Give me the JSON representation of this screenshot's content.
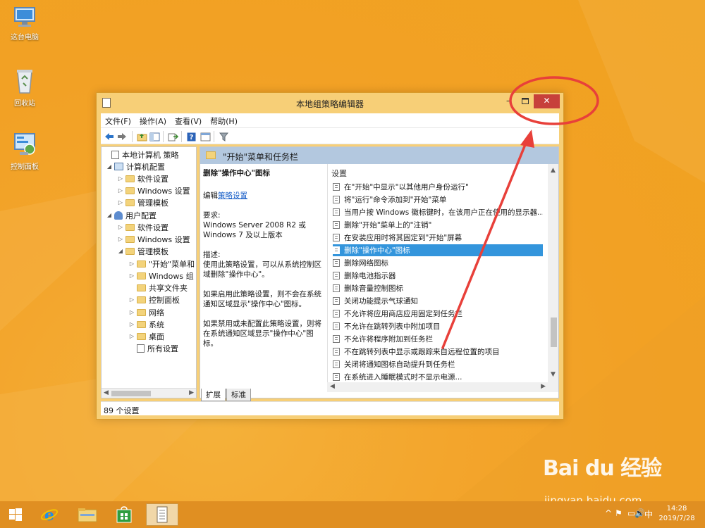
{
  "desktop": {
    "icons": [
      {
        "label": "这台电脑",
        "icon": "computer-icon"
      },
      {
        "label": "回收站",
        "icon": "recycle-bin-icon"
      },
      {
        "label": "控制面板",
        "icon": "control-panel-icon"
      }
    ]
  },
  "window": {
    "title": "本地组策略编辑器",
    "controls": {
      "minimize": "–",
      "maximize": "□",
      "close": "✕"
    },
    "menu": [
      "文件(F)",
      "操作(A)",
      "查看(V)",
      "帮助(H)"
    ],
    "toolbar_icons": [
      "back-icon",
      "forward-icon",
      "up-folder-icon",
      "show-hide-tree-icon",
      "export-icon",
      "help-icon",
      "properties-icon",
      "filter-icon"
    ],
    "tree": [
      {
        "label": "本地计算机 策略",
        "icon": "doc",
        "expander": ""
      },
      {
        "label": "计算机配置",
        "icon": "pc",
        "expander": "◢"
      },
      {
        "label": "软件设置",
        "icon": "folder",
        "expander": "▷"
      },
      {
        "label": "Windows 设置",
        "icon": "folder",
        "expander": "▷"
      },
      {
        "label": "管理模板",
        "icon": "folder",
        "expander": "▷"
      },
      {
        "label": "用户配置",
        "icon": "user",
        "expander": "◢"
      },
      {
        "label": "软件设置",
        "icon": "folder",
        "expander": "▷"
      },
      {
        "label": "Windows 设置",
        "icon": "folder",
        "expander": "▷"
      },
      {
        "label": "管理模板",
        "icon": "folder",
        "expander": "◢"
      },
      {
        "label": "\"开始\"菜单和",
        "icon": "folder",
        "expander": "▷"
      },
      {
        "label": "Windows 组",
        "icon": "folder",
        "expander": "▷"
      },
      {
        "label": "共享文件夹",
        "icon": "folder",
        "expander": ""
      },
      {
        "label": "控制面板",
        "icon": "folder",
        "expander": "▷"
      },
      {
        "label": "网络",
        "icon": "folder",
        "expander": "▷"
      },
      {
        "label": "系统",
        "icon": "folder",
        "expander": "▷"
      },
      {
        "label": "桌面",
        "icon": "folder",
        "expander": "▷"
      },
      {
        "label": "所有设置",
        "icon": "doc",
        "expander": ""
      }
    ],
    "right_header": "\"开始\"菜单和任务栏",
    "description": {
      "heading": "删除\"操作中心\"图标",
      "edit_prefix": "编辑",
      "edit_link": "策略设置",
      "requirements_label": "要求:",
      "requirements": "Windows Server 2008 R2 或 Windows 7 及以上版本",
      "desc_label": "描述:",
      "desc": "使用此策略设置，可以从系统控制区域删除\"操作中心\"。",
      "enabled": "如果启用此策略设置，则不会在系统通知区域显示\"操作中心\"图标。",
      "disabled": "如果禁用或未配置此策略设置，则将在系统通知区域显示\"操作中心\"图标。"
    },
    "settings_column": "设置",
    "settings": [
      "在\"开始\"中显示\"以其他用户身份运行\"",
      "将\"运行\"命令添加到\"开始\"菜单",
      "当用户按 Windows 徽标键时，在该用户正在使用的显示器...",
      "删除\"开始\"菜单上的\"注销\"",
      "在安装应用时将其固定到\"开始\"屏幕",
      "删除\"操作中心\"图标",
      "删除网络图标",
      "删除电池指示器",
      "删除音量控制图标",
      "关闭功能提示气球通知",
      "不允许将应用商店应用固定到任务栏",
      "不允许在跳转列表中附加项目",
      "不允许将程序附加到任务栏",
      "不在跳转列表中显示或跟踪来自远程位置的项目",
      "关闭将通知图标自动提升到任务栏",
      "在系统进入睡眠模式时不显示电源..."
    ],
    "selected_setting_index": 5,
    "tabs": [
      "扩展",
      "标准"
    ],
    "status": "89 个设置"
  },
  "taskbar": {
    "apps": [
      "windows-start-icon",
      "internet-explorer-icon",
      "file-explorer-icon",
      "store-icon",
      "group-policy-editor-icon"
    ],
    "tray": [
      "^",
      "⚑",
      "▭",
      "🔊",
      "中"
    ],
    "time": "14:28",
    "date": "2019/7/28"
  },
  "watermark": {
    "logo": "Bai du 经验",
    "url": "jingyan.baidu.com"
  },
  "colors": {
    "wallpaper": "#f2a125",
    "window_frame": "#f7cf77",
    "close_button": "#c7403b",
    "selection": "#3395dc",
    "annotation": "#e8403a"
  }
}
